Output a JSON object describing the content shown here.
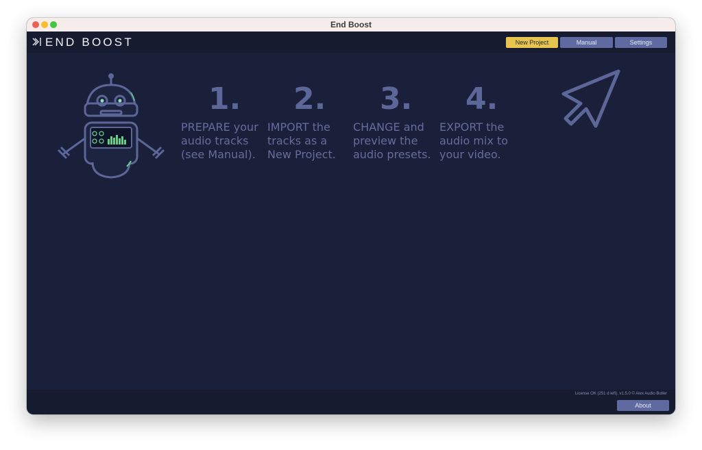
{
  "window": {
    "title": "End Boost"
  },
  "header": {
    "app_name": "END BOOST",
    "buttons": {
      "new_project": "New Project",
      "manual": "Manual",
      "settings": "Settings"
    }
  },
  "steps": [
    {
      "number": "1.",
      "text_lines": [
        "PREPARE your",
        "audio tracks",
        "(see Manual)."
      ]
    },
    {
      "number": "2.",
      "text_lines": [
        "IMPORT the",
        "tracks as a",
        "New Project."
      ]
    },
    {
      "number": "3.",
      "text_lines": [
        "CHANGE and",
        "preview the",
        "audio presets."
      ]
    },
    {
      "number": "4.",
      "text_lines": [
        "EXPORT the",
        "audio mix to",
        "your video."
      ]
    }
  ],
  "footer": {
    "license": "License OK (251 d left).  v1.5.0 © Alex Audio Butler",
    "about_label": "About"
  },
  "colors": {
    "background": "#1a2039",
    "header_bg": "#161b30",
    "accent_yellow": "#e6c44f",
    "button_blue": "#5f6aa1",
    "step_text": "#646d9c",
    "robot_lines": "#5d6699",
    "robot_screen_green": "#5fd18a"
  },
  "icons": {
    "logo": "boost-logo-icon",
    "robot": "robot-illustration",
    "arrow": "cursor-arrow-icon"
  }
}
